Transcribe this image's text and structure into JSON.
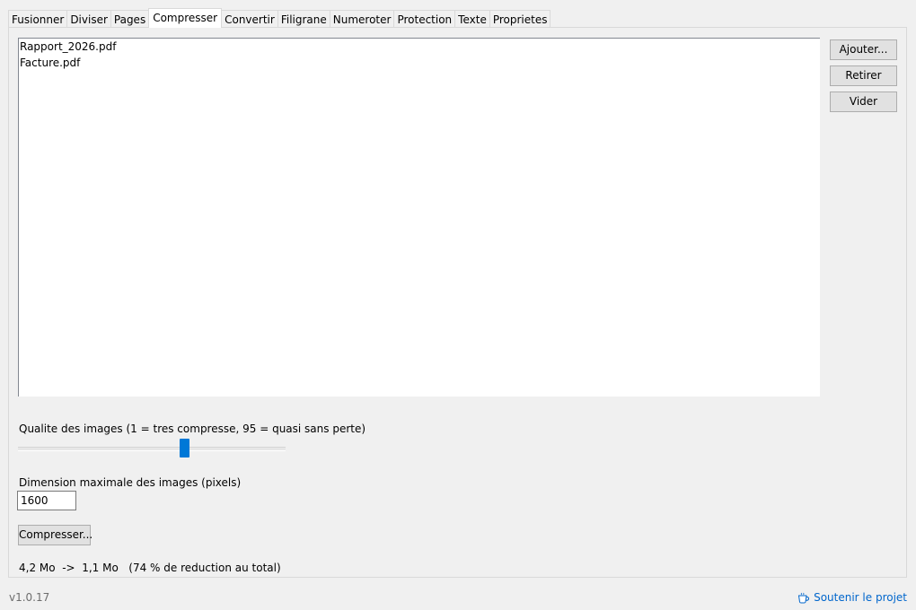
{
  "tabs": [
    "Fusionner",
    "Diviser",
    "Pages",
    "Compresser",
    "Convertir",
    "Filigrane",
    "Numeroter",
    "Protection",
    "Texte",
    "Proprietes"
  ],
  "active_tab": "Compresser",
  "files": [
    "Rapport_2026.pdf",
    "Facture.pdf"
  ],
  "buttons": {
    "add": "Ajouter...",
    "remove": "Retirer",
    "clear": "Vider",
    "compress": "Compresser..."
  },
  "quality": {
    "label": "Qualite des images (1 = tres compresse, 95 = quasi sans perte)",
    "min": 1,
    "max": 95,
    "value": 60
  },
  "max_dimension": {
    "label": "Dimension maximale des images (pixels)",
    "value": "1600"
  },
  "result": "4,2 Mo  ->  1,1 Mo   (74 % de reduction au total)",
  "footer": {
    "version": "v1.0.17",
    "support_link": "Soutenir le projet",
    "support_icon": "coffee-cup-icon",
    "link_color": "#0066cc"
  },
  "accent_color": "#0078d7"
}
